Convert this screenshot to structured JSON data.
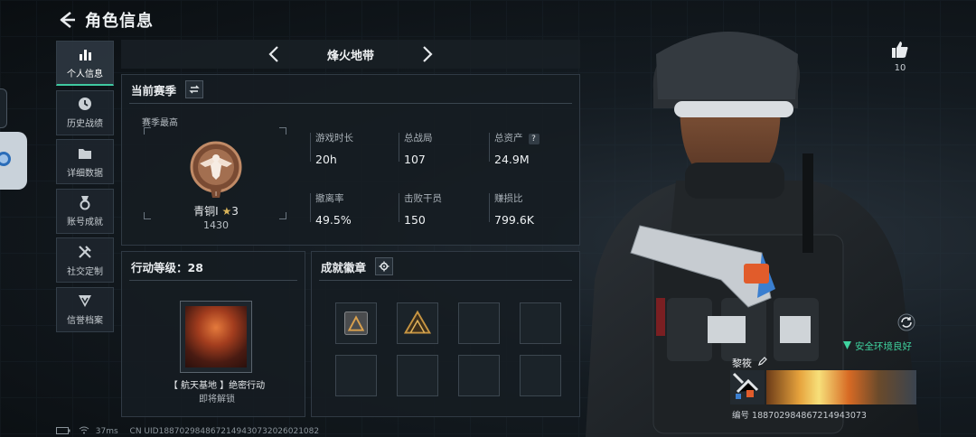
{
  "header": {
    "title": "角色信息"
  },
  "sidebar": {
    "items": [
      {
        "label": "个人信息",
        "icon": "bar-chart-icon",
        "active": true
      },
      {
        "label": "历史战绩",
        "icon": "clock-icon"
      },
      {
        "label": "详细数据",
        "icon": "folder-icon"
      },
      {
        "label": "账号成就",
        "icon": "medal-icon"
      },
      {
        "label": "社交定制",
        "icon": "tools-icon"
      },
      {
        "label": "信誉档案",
        "icon": "shield-icon"
      }
    ]
  },
  "mode": {
    "title": "烽火地带"
  },
  "season": {
    "title": "当前赛季",
    "subtitle": "赛季最高",
    "rank_name": "青铜Ⅰ",
    "rank_star": "★",
    "rank_stars": "3",
    "rank_score": "1430",
    "stats": [
      {
        "label": "游戏时长",
        "value": "20h"
      },
      {
        "label": "总战局",
        "value": "107"
      },
      {
        "label": "总资产",
        "value": "24.9M",
        "help": "?"
      },
      {
        "label": "撤离率",
        "value": "49.5%"
      },
      {
        "label": "击败干员",
        "value": "150"
      },
      {
        "label": "赚损比",
        "value": "799.6K"
      }
    ]
  },
  "operations": {
    "title": "行动等级：28",
    "item_name": "【 航天基地 】绝密行动",
    "item_status": "即将解锁"
  },
  "badges": {
    "title": "成就徽章"
  },
  "profile": {
    "likes": "10",
    "environment": "安全环境良好",
    "name": "黎筱",
    "id_line": "编号 188702984867214943073"
  },
  "footer": {
    "ping": "37ms",
    "uid": "CN UID1887029848672149430732026021082"
  },
  "colors": {
    "accent": "#3fc9a0",
    "bronze": "#b07a56",
    "background": "#0d1216"
  }
}
